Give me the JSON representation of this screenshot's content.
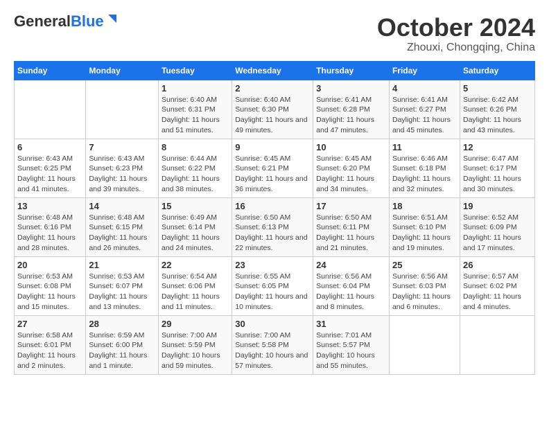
{
  "logo": {
    "line1": "General",
    "line2": "Blue"
  },
  "title": "October 2024",
  "subtitle": "Zhouxi, Chongqing, China",
  "weekdays": [
    "Sunday",
    "Monday",
    "Tuesday",
    "Wednesday",
    "Thursday",
    "Friday",
    "Saturday"
  ],
  "weeks": [
    [
      {
        "num": "",
        "info": ""
      },
      {
        "num": "",
        "info": ""
      },
      {
        "num": "1",
        "info": "Sunrise: 6:40 AM\nSunset: 6:31 PM\nDaylight: 11 hours and 51 minutes."
      },
      {
        "num": "2",
        "info": "Sunrise: 6:40 AM\nSunset: 6:30 PM\nDaylight: 11 hours and 49 minutes."
      },
      {
        "num": "3",
        "info": "Sunrise: 6:41 AM\nSunset: 6:28 PM\nDaylight: 11 hours and 47 minutes."
      },
      {
        "num": "4",
        "info": "Sunrise: 6:41 AM\nSunset: 6:27 PM\nDaylight: 11 hours and 45 minutes."
      },
      {
        "num": "5",
        "info": "Sunrise: 6:42 AM\nSunset: 6:26 PM\nDaylight: 11 hours and 43 minutes."
      }
    ],
    [
      {
        "num": "6",
        "info": "Sunrise: 6:43 AM\nSunset: 6:25 PM\nDaylight: 11 hours and 41 minutes."
      },
      {
        "num": "7",
        "info": "Sunrise: 6:43 AM\nSunset: 6:23 PM\nDaylight: 11 hours and 39 minutes."
      },
      {
        "num": "8",
        "info": "Sunrise: 6:44 AM\nSunset: 6:22 PM\nDaylight: 11 hours and 38 minutes."
      },
      {
        "num": "9",
        "info": "Sunrise: 6:45 AM\nSunset: 6:21 PM\nDaylight: 11 hours and 36 minutes."
      },
      {
        "num": "10",
        "info": "Sunrise: 6:45 AM\nSunset: 6:20 PM\nDaylight: 11 hours and 34 minutes."
      },
      {
        "num": "11",
        "info": "Sunrise: 6:46 AM\nSunset: 6:18 PM\nDaylight: 11 hours and 32 minutes."
      },
      {
        "num": "12",
        "info": "Sunrise: 6:47 AM\nSunset: 6:17 PM\nDaylight: 11 hours and 30 minutes."
      }
    ],
    [
      {
        "num": "13",
        "info": "Sunrise: 6:48 AM\nSunset: 6:16 PM\nDaylight: 11 hours and 28 minutes."
      },
      {
        "num": "14",
        "info": "Sunrise: 6:48 AM\nSunset: 6:15 PM\nDaylight: 11 hours and 26 minutes."
      },
      {
        "num": "15",
        "info": "Sunrise: 6:49 AM\nSunset: 6:14 PM\nDaylight: 11 hours and 24 minutes."
      },
      {
        "num": "16",
        "info": "Sunrise: 6:50 AM\nSunset: 6:13 PM\nDaylight: 11 hours and 22 minutes."
      },
      {
        "num": "17",
        "info": "Sunrise: 6:50 AM\nSunset: 6:11 PM\nDaylight: 11 hours and 21 minutes."
      },
      {
        "num": "18",
        "info": "Sunrise: 6:51 AM\nSunset: 6:10 PM\nDaylight: 11 hours and 19 minutes."
      },
      {
        "num": "19",
        "info": "Sunrise: 6:52 AM\nSunset: 6:09 PM\nDaylight: 11 hours and 17 minutes."
      }
    ],
    [
      {
        "num": "20",
        "info": "Sunrise: 6:53 AM\nSunset: 6:08 PM\nDaylight: 11 hours and 15 minutes."
      },
      {
        "num": "21",
        "info": "Sunrise: 6:53 AM\nSunset: 6:07 PM\nDaylight: 11 hours and 13 minutes."
      },
      {
        "num": "22",
        "info": "Sunrise: 6:54 AM\nSunset: 6:06 PM\nDaylight: 11 hours and 11 minutes."
      },
      {
        "num": "23",
        "info": "Sunrise: 6:55 AM\nSunset: 6:05 PM\nDaylight: 11 hours and 10 minutes."
      },
      {
        "num": "24",
        "info": "Sunrise: 6:56 AM\nSunset: 6:04 PM\nDaylight: 11 hours and 8 minutes."
      },
      {
        "num": "25",
        "info": "Sunrise: 6:56 AM\nSunset: 6:03 PM\nDaylight: 11 hours and 6 minutes."
      },
      {
        "num": "26",
        "info": "Sunrise: 6:57 AM\nSunset: 6:02 PM\nDaylight: 11 hours and 4 minutes."
      }
    ],
    [
      {
        "num": "27",
        "info": "Sunrise: 6:58 AM\nSunset: 6:01 PM\nDaylight: 11 hours and 2 minutes."
      },
      {
        "num": "28",
        "info": "Sunrise: 6:59 AM\nSunset: 6:00 PM\nDaylight: 11 hours and 1 minute."
      },
      {
        "num": "29",
        "info": "Sunrise: 7:00 AM\nSunset: 5:59 PM\nDaylight: 10 hours and 59 minutes."
      },
      {
        "num": "30",
        "info": "Sunrise: 7:00 AM\nSunset: 5:58 PM\nDaylight: 10 hours and 57 minutes."
      },
      {
        "num": "31",
        "info": "Sunrise: 7:01 AM\nSunset: 5:57 PM\nDaylight: 10 hours and 55 minutes."
      },
      {
        "num": "",
        "info": ""
      },
      {
        "num": "",
        "info": ""
      }
    ]
  ]
}
